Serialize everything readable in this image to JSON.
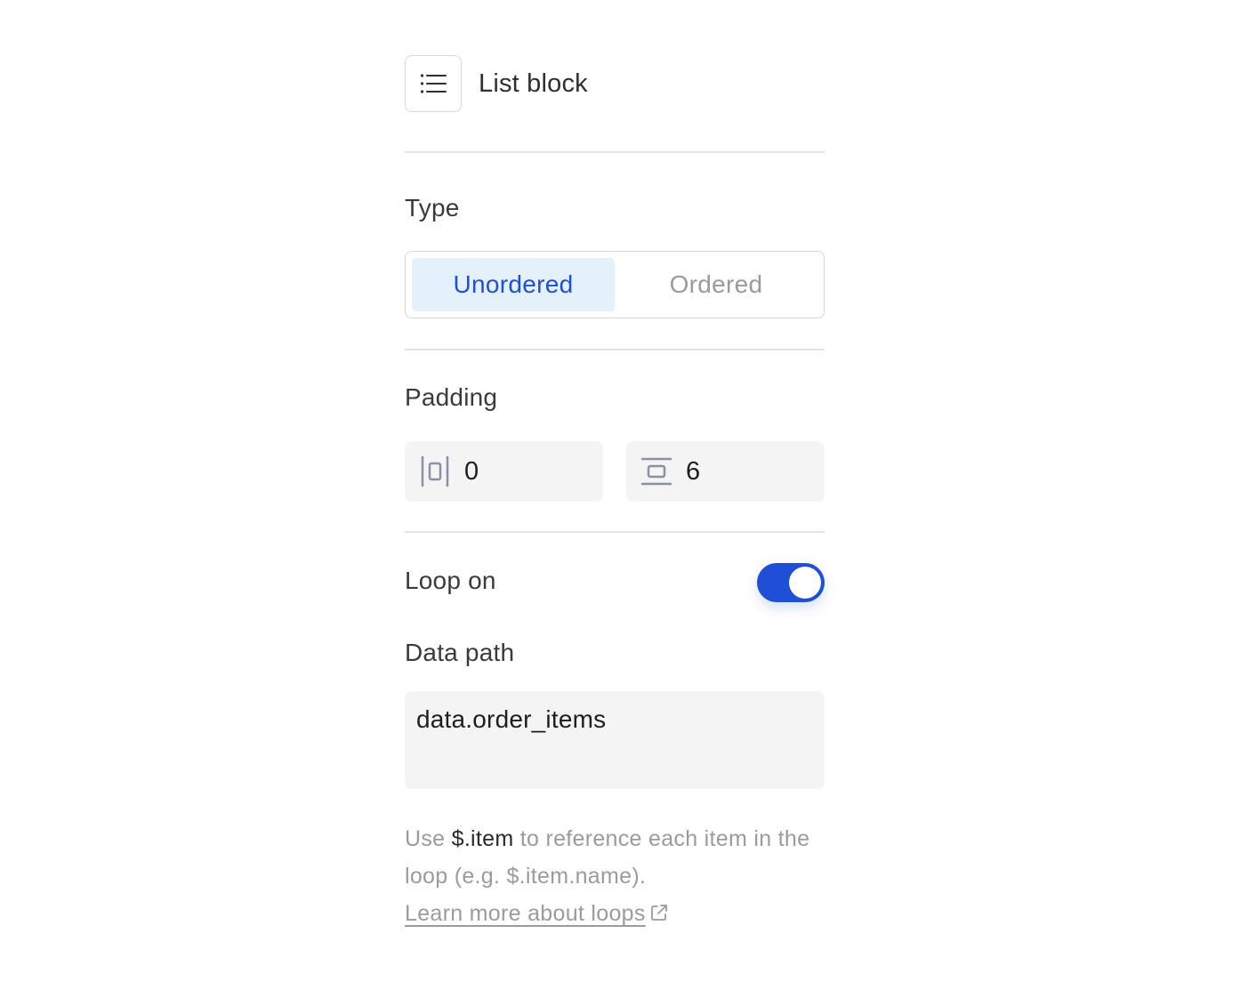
{
  "header": {
    "title": "List block",
    "icon": "list-icon"
  },
  "type_section": {
    "label": "Type",
    "options": [
      "Unordered",
      "Ordered"
    ],
    "selected": "Unordered",
    "accent_color": "#1f4fd6",
    "selected_bg": "#e4f1fd"
  },
  "padding_section": {
    "label": "Padding",
    "horizontal": {
      "icon": "horizontal-padding-icon",
      "value": "0"
    },
    "vertical": {
      "icon": "vertical-padding-icon",
      "value": "6"
    }
  },
  "loop": {
    "label": "Loop on",
    "enabled": true,
    "toggle_color": "#1f4fd6"
  },
  "data_path": {
    "label": "Data path",
    "value": "data.order_items"
  },
  "help": {
    "prefix": "Use ",
    "code": "$.item",
    "suffix": " to reference each item in the loop (e.g. $.item.name).",
    "link_label": "Learn more about loops",
    "link_icon": "external-link-icon"
  }
}
